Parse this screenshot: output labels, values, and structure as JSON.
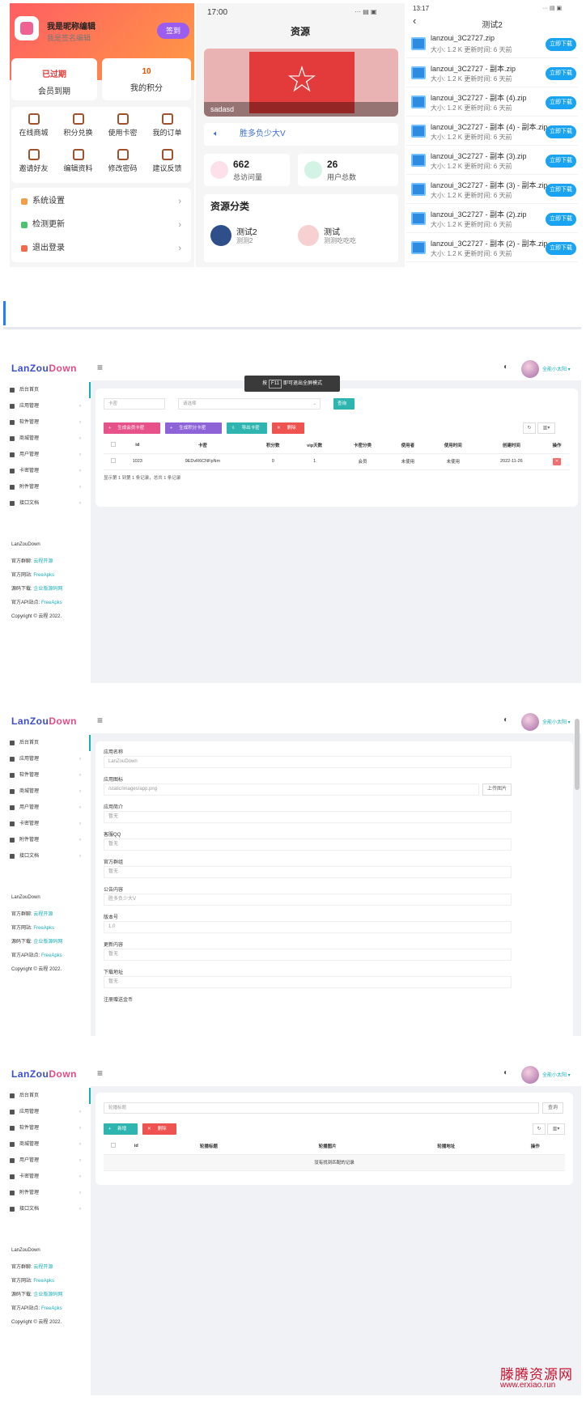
{
  "phone1": {
    "nickname": "我是昵称编辑",
    "signature": "我是签名编辑",
    "checkin_label": "签到",
    "member_status": "已过期",
    "member_label": "会员到期",
    "points_value": "10",
    "points_label": "我的积分",
    "grid": [
      {
        "label": "在线商城",
        "icon": "cart-icon"
      },
      {
        "label": "积分兑换",
        "icon": "diamond-icon"
      },
      {
        "label": "使用卡密",
        "icon": "gift-icon"
      },
      {
        "label": "我的订单",
        "icon": "order-icon"
      },
      {
        "label": "邀请好友",
        "icon": "invite-icon"
      },
      {
        "label": "编辑资料",
        "icon": "edit-icon"
      },
      {
        "label": "修改密码",
        "icon": "lock-icon"
      },
      {
        "label": "建议反馈",
        "icon": "feedback-icon"
      }
    ],
    "menu": [
      {
        "label": "系统设置",
        "color": "#f0a04b"
      },
      {
        "label": "检测更新",
        "color": "#4bc26b"
      },
      {
        "label": "退出登录",
        "color": "#f06a4b"
      }
    ]
  },
  "phone2": {
    "time": "17:00",
    "status": "··· ▤ ▣",
    "title": "资源",
    "banner_caption": "sadasd",
    "notice": "胜多负少大V",
    "stat1_value": "662",
    "stat1_label": "总访问量",
    "stat2_value": "26",
    "stat2_label": "用户总数",
    "category_title": "资源分类",
    "categories": [
      {
        "name": "测试2",
        "desc": "测测2"
      },
      {
        "name": "测试",
        "desc": "测测吃吃吃"
      }
    ]
  },
  "phone3": {
    "time": "13:17",
    "status": "··· ▤ ▣",
    "title": "测试2",
    "download_label": "立即下载",
    "files": [
      {
        "name": "lanzoui_3C2727.zip",
        "meta": "大小:  1.2 K  更新时间:  6 天前"
      },
      {
        "name": "lanzoui_3C2727 - 副本.zip",
        "meta": "大小:  1.2 K  更新时间:  6 天前"
      },
      {
        "name": "lanzoui_3C2727 - 副本 (4).zip",
        "meta": "大小:  1.2 K  更新时间:  6 天前"
      },
      {
        "name": "lanzoui_3C2727 - 副本 (4) - 副本.zip",
        "meta": "大小:  1.2 K  更新时间:  6 天前"
      },
      {
        "name": "lanzoui_3C2727 - 副本 (3).zip",
        "meta": "大小:  1.2 K  更新时间:  6 天前"
      },
      {
        "name": "lanzoui_3C2727 - 副本 (3) - 副本.zip",
        "meta": "大小:  1.2 K  更新时间:  6 天前"
      },
      {
        "name": "lanzoui_3C2727 - 副本 (2).zip",
        "meta": "大小:  1.2 K  更新时间:  6 天前"
      },
      {
        "name": "lanzoui_3C2727 - 副本 (2) - 副本.zip",
        "meta": "大小:  1.2 K  更新时间:  6 天前"
      }
    ]
  },
  "admin": {
    "logo_a": "LanZou",
    "logo_b": "Down",
    "username": "全能小太阳 ▾",
    "menu": [
      "后台首页",
      "应用管理",
      "软件管理",
      "商城管理",
      "用户管理",
      "卡密管理",
      "附件管理",
      "接口文档"
    ],
    "info_title": "LanZouDown",
    "info": [
      {
        "label": "官方群聊:",
        "link": "云程开源"
      },
      {
        "label": "官方网站:",
        "link": "FreeApks"
      },
      {
        "label": "源码下载:",
        "link": "企业版源码网"
      },
      {
        "label": "官方API站点:",
        "link": "FreeApks"
      }
    ],
    "copyright": "Copyright © 云程 2022."
  },
  "panel1": {
    "toast_pre": "按",
    "toast_key": "F11",
    "toast_post": "即可退出全屏模式",
    "search_placeholder": "卡密",
    "select_placeholder": "请选择",
    "query_label": "查询",
    "buttons": [
      {
        "label": "生成会员卡密",
        "color": "#e8528a"
      },
      {
        "label": "生成积分卡密",
        "color": "#8e63d8"
      },
      {
        "label": "导出卡密",
        "color": "#2fb5b0"
      },
      {
        "label": "删除",
        "color": "#ef5350"
      }
    ],
    "columns": [
      "id",
      "卡密",
      "积分数",
      "vip天数",
      "卡密分类",
      "使用者",
      "使用时间",
      "创建时间",
      "操作"
    ],
    "rows": [
      [
        "1023",
        "9EDvR6CNFpNm",
        "0",
        "1",
        "会员",
        "未使用",
        "未使用",
        "2022-11-26"
      ]
    ],
    "footer": "显示第 1 到第 1 条记录，总共 1 条记录"
  },
  "panel2": {
    "fields": [
      {
        "label": "应用名称",
        "value": "LanZouDown"
      },
      {
        "label": "应用图标",
        "value": "/static/images/app.png"
      },
      {
        "label": "应用简介",
        "value": "暂无"
      },
      {
        "label": "客服QQ",
        "value": "暂无"
      },
      {
        "label": "官方群组",
        "value": "暂无"
      },
      {
        "label": "公告内容",
        "value": "胜多负少大V"
      },
      {
        "label": "版本号",
        "value": "1.0"
      },
      {
        "label": "更新内容",
        "value": "暂无"
      },
      {
        "label": "下载地址",
        "value": "暂无"
      }
    ],
    "upload_label": "上传图片",
    "last_label": "注册赠送金币"
  },
  "panel3": {
    "search_placeholder": "轮播标题",
    "query_label": "查询",
    "add_label": "新增",
    "delete_label": "删除",
    "columns": [
      "id",
      "轮播标题",
      "轮播图片",
      "轮播地址",
      "操作"
    ],
    "empty": "没有找到匹配的记录"
  },
  "watermark": {
    "name": "滕腾资源网",
    "url": "www.erxiao.run"
  }
}
